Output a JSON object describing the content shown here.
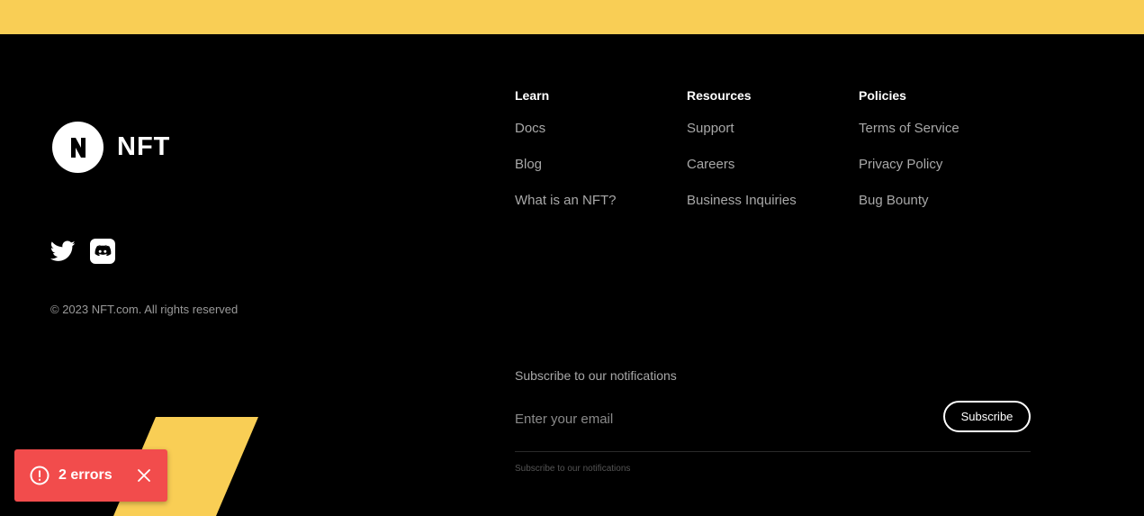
{
  "brand": {
    "logo_icon": "nft-logo-icon",
    "name": "NFT"
  },
  "socials": [
    {
      "icon": "twitter-icon"
    },
    {
      "icon": "discord-icon"
    }
  ],
  "copyright": "© 2023 NFT.com. All rights reserved",
  "columns": {
    "learn": {
      "title": "Learn",
      "links": [
        "Docs",
        "Blog",
        "What is an NFT?"
      ]
    },
    "resources": {
      "title": "Resources",
      "links": [
        "Support",
        "Careers",
        "Business Inquiries"
      ]
    },
    "policies": {
      "title": "Policies",
      "links": [
        "Terms of Service",
        "Privacy Policy",
        "Bug Bounty"
      ]
    }
  },
  "subscribe": {
    "title": "Subscribe to our notifications",
    "email_placeholder": "Enter your email",
    "button_label": "Subscribe",
    "hint": "Subscribe to our notifications"
  },
  "toast": {
    "icon": "alert-circle-icon",
    "text": "2 errors",
    "close_icon": "close-icon"
  },
  "colors": {
    "accent_yellow": "#F9CE55",
    "background": "#000000",
    "error_red": "#F24C4C"
  }
}
